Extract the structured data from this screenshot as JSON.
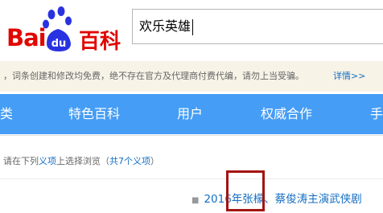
{
  "logo": {
    "bai_text": "Bai",
    "du_text": "du",
    "baike_text": "百科",
    "brand_red": "#e10602",
    "paw_blue": "#2932e1"
  },
  "search": {
    "value": "欢乐英雄"
  },
  "notice": {
    "text": "，词条创建和修改均免费，绝不存在官方及代理商付费代编，请勿上当受骗。",
    "link_label": "详情>>"
  },
  "nav": {
    "bg_color": "#459df5",
    "items": [
      "类",
      "特色百科",
      "用户",
      "权威合作",
      "手"
    ]
  },
  "disambiguation": {
    "prefix": "请在下列",
    "term": "义项",
    "middle": "上选择浏览（",
    "count": "共7个义项",
    "suffix": "）"
  },
  "meanings": [
    "2016年张檬、蔡俊涛主演武侠剧"
  ],
  "colors": {
    "link_blue": "#136ec2",
    "annotation_box": "#a31411"
  }
}
